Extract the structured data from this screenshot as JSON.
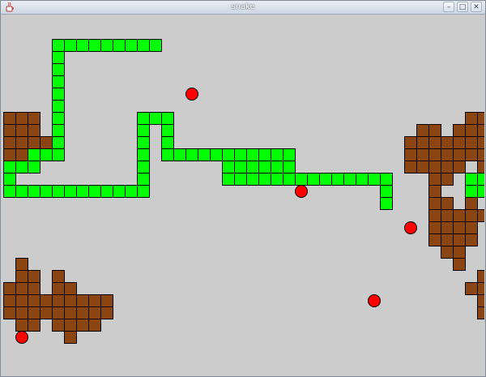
{
  "window": {
    "title": "snake",
    "icon": "java-cup-icon",
    "buttons": [
      {
        "name": "minimize-button",
        "glyph": "–"
      },
      {
        "name": "maximize-button",
        "glyph": "□"
      },
      {
        "name": "close-button",
        "glyph": "✕"
      }
    ]
  },
  "colors": {
    "background": "#cccccc",
    "snake": "#00ff00",
    "obstacle": "#8b4513",
    "food": "#ff0000",
    "cell_border": "#000000"
  },
  "game": {
    "snake_cells": [
      [
        4,
        2
      ],
      [
        5,
        2
      ],
      [
        6,
        2
      ],
      [
        7,
        2
      ],
      [
        8,
        2
      ],
      [
        9,
        2
      ],
      [
        10,
        2
      ],
      [
        11,
        2
      ],
      [
        12,
        2
      ],
      [
        4,
        3
      ],
      [
        4,
        4
      ],
      [
        4,
        5
      ],
      [
        4,
        6
      ],
      [
        4,
        7
      ],
      [
        4,
        8
      ],
      [
        4,
        9
      ],
      [
        4,
        10
      ],
      [
        4,
        11
      ],
      [
        3,
        11
      ],
      [
        2,
        11
      ],
      [
        2,
        12
      ],
      [
        1,
        12
      ],
      [
        0,
        12
      ],
      [
        0,
        13
      ],
      [
        0,
        14
      ],
      [
        1,
        14
      ],
      [
        2,
        14
      ],
      [
        3,
        14
      ],
      [
        4,
        14
      ],
      [
        5,
        14
      ],
      [
        6,
        14
      ],
      [
        7,
        14
      ],
      [
        8,
        14
      ],
      [
        9,
        14
      ],
      [
        10,
        14
      ],
      [
        11,
        14
      ],
      [
        11,
        13
      ],
      [
        11,
        12
      ],
      [
        11,
        11
      ],
      [
        11,
        10
      ],
      [
        11,
        9
      ],
      [
        11,
        8
      ],
      [
        12,
        8
      ],
      [
        13,
        8
      ],
      [
        13,
        9
      ],
      [
        13,
        10
      ],
      [
        13,
        11
      ],
      [
        14,
        11
      ],
      [
        15,
        11
      ],
      [
        16,
        11
      ],
      [
        17,
        11
      ],
      [
        18,
        11
      ],
      [
        19,
        11
      ],
      [
        20,
        11
      ],
      [
        21,
        11
      ],
      [
        22,
        11
      ],
      [
        23,
        11
      ],
      [
        18,
        12
      ],
      [
        19,
        12
      ],
      [
        20,
        12
      ],
      [
        21,
        12
      ],
      [
        22,
        12
      ],
      [
        23,
        12
      ],
      [
        18,
        13
      ],
      [
        19,
        13
      ],
      [
        20,
        13
      ],
      [
        21,
        13
      ],
      [
        22,
        13
      ],
      [
        23,
        13
      ],
      [
        24,
        13
      ],
      [
        25,
        13
      ],
      [
        26,
        13
      ],
      [
        27,
        13
      ],
      [
        28,
        13
      ],
      [
        29,
        13
      ],
      [
        30,
        13
      ],
      [
        31,
        13
      ],
      [
        31,
        14
      ],
      [
        31,
        15
      ],
      [
        38,
        13
      ],
      [
        39,
        13
      ],
      [
        38,
        14
      ],
      [
        39,
        14
      ]
    ],
    "obstacle_cells": [
      [
        0,
        8
      ],
      [
        1,
        8
      ],
      [
        2,
        8
      ],
      [
        0,
        9
      ],
      [
        1,
        9
      ],
      [
        2,
        9
      ],
      [
        0,
        10
      ],
      [
        1,
        10
      ],
      [
        2,
        10
      ],
      [
        3,
        10
      ],
      [
        0,
        11
      ],
      [
        1,
        11
      ],
      [
        34,
        9
      ],
      [
        35,
        9
      ],
      [
        37,
        9
      ],
      [
        38,
        9
      ],
      [
        33,
        10
      ],
      [
        34,
        10
      ],
      [
        35,
        10
      ],
      [
        36,
        10
      ],
      [
        37,
        10
      ],
      [
        38,
        10
      ],
      [
        33,
        11
      ],
      [
        34,
        11
      ],
      [
        35,
        11
      ],
      [
        36,
        11
      ],
      [
        37,
        11
      ],
      [
        38,
        11
      ],
      [
        33,
        12
      ],
      [
        34,
        12
      ],
      [
        35,
        12
      ],
      [
        36,
        12
      ],
      [
        37,
        12
      ],
      [
        35,
        13
      ],
      [
        36,
        13
      ],
      [
        35,
        14
      ],
      [
        35,
        15
      ],
      [
        36,
        15
      ],
      [
        38,
        15
      ],
      [
        35,
        16
      ],
      [
        36,
        16
      ],
      [
        37,
        16
      ],
      [
        38,
        16
      ],
      [
        39,
        16
      ],
      [
        35,
        17
      ],
      [
        36,
        17
      ],
      [
        37,
        17
      ],
      [
        38,
        17
      ],
      [
        35,
        18
      ],
      [
        36,
        18
      ],
      [
        37,
        18
      ],
      [
        38,
        18
      ],
      [
        36,
        19
      ],
      [
        37,
        19
      ],
      [
        37,
        20
      ],
      [
        38,
        8
      ],
      [
        39,
        8
      ],
      [
        39,
        9
      ],
      [
        39,
        10
      ],
      [
        39,
        11
      ],
      [
        39,
        12
      ],
      [
        1,
        20
      ],
      [
        1,
        21
      ],
      [
        2,
        21
      ],
      [
        4,
        21
      ],
      [
        0,
        22
      ],
      [
        1,
        22
      ],
      [
        2,
        22
      ],
      [
        4,
        22
      ],
      [
        5,
        22
      ],
      [
        0,
        23
      ],
      [
        1,
        23
      ],
      [
        2,
        23
      ],
      [
        3,
        23
      ],
      [
        4,
        23
      ],
      [
        5,
        23
      ],
      [
        6,
        23
      ],
      [
        7,
        23
      ],
      [
        8,
        23
      ],
      [
        0,
        24
      ],
      [
        1,
        24
      ],
      [
        2,
        24
      ],
      [
        3,
        24
      ],
      [
        4,
        24
      ],
      [
        5,
        24
      ],
      [
        6,
        24
      ],
      [
        7,
        24
      ],
      [
        8,
        24
      ],
      [
        1,
        25
      ],
      [
        2,
        25
      ],
      [
        4,
        25
      ],
      [
        5,
        25
      ],
      [
        6,
        25
      ],
      [
        7,
        25
      ],
      [
        5,
        26
      ],
      [
        39,
        21
      ],
      [
        38,
        22
      ],
      [
        39,
        22
      ],
      [
        39,
        23
      ],
      [
        39,
        24
      ]
    ],
    "food": [
      {
        "col": 15,
        "row": 6
      },
      {
        "col": 24,
        "row": 14
      },
      {
        "col": 33,
        "row": 17
      },
      {
        "col": 30,
        "row": 23
      },
      {
        "col": 1,
        "row": 26
      }
    ]
  }
}
